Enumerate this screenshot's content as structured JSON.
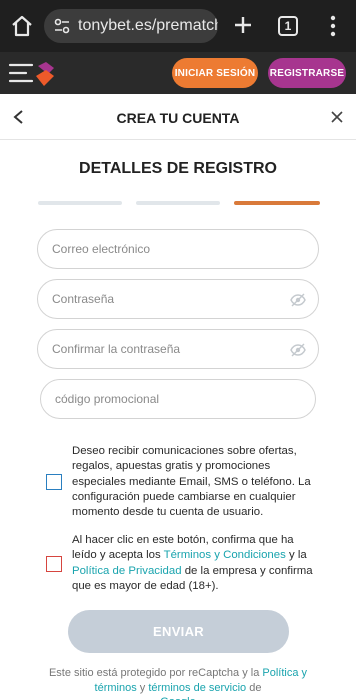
{
  "browser": {
    "url": "tonybet.es/prematch",
    "tab_count": "1"
  },
  "header": {
    "login_label": "INICIAR SESIÓN",
    "register_label": "REGISTRARSE"
  },
  "modal": {
    "title": "CREA TU CUENTA"
  },
  "form": {
    "section_title": "DETALLES DE REGISTRO",
    "steps": [
      {
        "state": "done"
      },
      {
        "state": "done"
      },
      {
        "state": "active"
      }
    ],
    "email_placeholder": "Correo electrónico",
    "password_placeholder": "Contraseña",
    "confirm_placeholder": "Confirmar la contraseña",
    "promo_placeholder": "código promocional",
    "newsletter_text": "Deseo recibir comunicaciones sobre ofertas, regalos, apuestas gratis y promociones especiales mediante Email, SMS o teléfono. La configuración puede cambiarse en cualquier momento desde tu cuenta de usuario.",
    "terms": {
      "part1": "Al hacer clic en este botón, confirma que ha leído y acepta los ",
      "link1": "Términos y Condiciones",
      "part2": " y la ",
      "link2": "Política de Privacidad",
      "part3": " de la empresa y confirma que es mayor de edad (18+)."
    },
    "submit_label": "ENVIAR"
  },
  "footer": {
    "part1": "Este sitio está protegido por reCaptcha y la ",
    "link1": "Política y términos",
    "part2": " y ",
    "link2": "términos de servicio",
    "part3": " de",
    "cut_line": "Google"
  },
  "colors": {
    "login_button": "#ed7b32",
    "register_button": "#a7358f",
    "active_step": "#d97a3a",
    "link": "#1aa4ae",
    "newsletter_checkbox_border": "#2a7fc0",
    "terms_checkbox_border": "#d6453f"
  }
}
